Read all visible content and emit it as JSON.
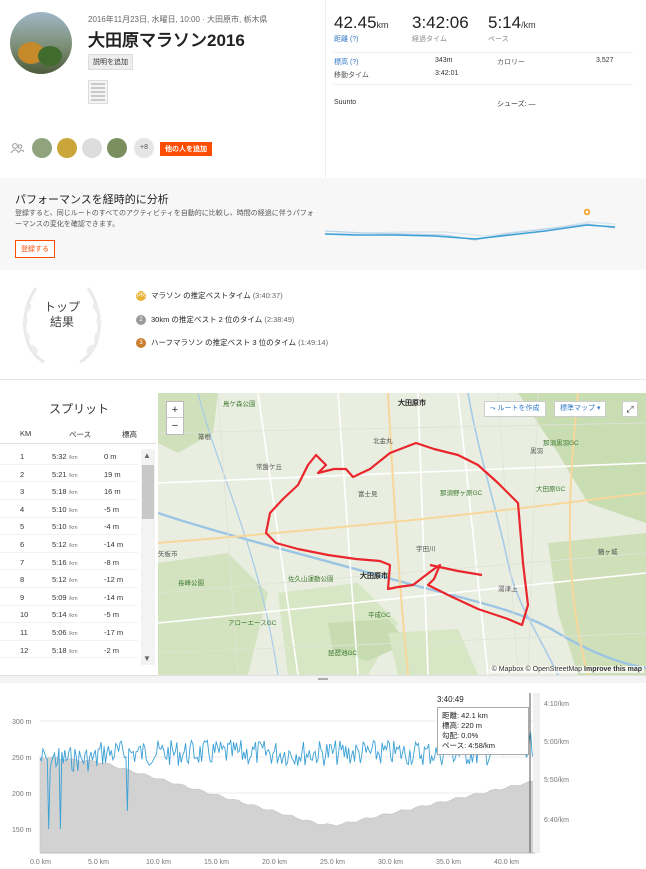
{
  "activity": {
    "meta": "2016年11月23日, 水曜日, 10:00 · 大田原市, 栃木県",
    "title": "大田原マラソン2016",
    "add_description": "説明を追加",
    "add_others": "他の人を追加",
    "others_count": "+8"
  },
  "stats": {
    "distance": {
      "value": "42.45",
      "unit": "km",
      "label": "距離 (?)"
    },
    "elapsed": {
      "value": "3:42:06",
      "unit": "",
      "label": "経過タイム"
    },
    "pace": {
      "value": "5:14",
      "unit": "/km",
      "label": "ペース"
    },
    "elevation_label": "標高 (?)",
    "elevation_value": "343m",
    "calories_label": "カロリー",
    "calories_value": "3,527",
    "moving_label": "移動タイム",
    "moving_value": "3:42:01",
    "device": "Suunto",
    "shoes_label": "シューズ: —"
  },
  "performance": {
    "title": "パフォーマンスを経時的に分析",
    "text": "登録すると、同じルートのすべてのアクティビティを自動的に比較し、時間の経過に伴うパフォーマンスの変化を確認できます。",
    "button": "登録する"
  },
  "top_results": {
    "title_line1": "トップ",
    "title_line2": "結果",
    "items": [
      {
        "medal": "PR",
        "text": "マラソン の推定ベストタイム",
        "time": "(3:40:37)",
        "color": "#e8b233"
      },
      {
        "medal": "2",
        "text": "30km の推定ベスト 2 位のタイム",
        "time": "(2:38:49)",
        "color": "#999999"
      },
      {
        "medal": "3",
        "text": "ハーフマラソン の推定ベスト 3 位のタイム",
        "time": "(1:49:14)",
        "color": "#c97f2e"
      }
    ]
  },
  "splits": {
    "title": "スプリット",
    "headers": [
      "KM",
      "ペース",
      "標高"
    ],
    "pace_unit": "/km",
    "rows": [
      {
        "km": "1",
        "pace": "5:32",
        "elev": "0 m"
      },
      {
        "km": "2",
        "pace": "5:21",
        "elev": "19 m"
      },
      {
        "km": "3",
        "pace": "5:18",
        "elev": "16 m"
      },
      {
        "km": "4",
        "pace": "5:10",
        "elev": "-5 m"
      },
      {
        "km": "5",
        "pace": "5:10",
        "elev": "-4 m"
      },
      {
        "km": "6",
        "pace": "5:12",
        "elev": "-14 m"
      },
      {
        "km": "7",
        "pace": "5:16",
        "elev": "-8 m"
      },
      {
        "km": "8",
        "pace": "5:12",
        "elev": "-12 m"
      },
      {
        "km": "9",
        "pace": "5:09",
        "elev": "-14 m"
      },
      {
        "km": "10",
        "pace": "5:14",
        "elev": "-5 m"
      },
      {
        "km": "11",
        "pace": "5:06",
        "elev": "-17 m"
      },
      {
        "km": "12",
        "pace": "5:18",
        "elev": "-2 m"
      }
    ]
  },
  "map": {
    "create_route": "ルートを作成",
    "map_type": "標準マップ",
    "zoom_in": "+",
    "zoom_out": "−",
    "fullscreen": "⤢",
    "attribution": "© Mapbox © OpenStreetMap",
    "improve": "Improve this map",
    "route_color": "#e8262c",
    "labels": [
      {
        "t": "大田原市",
        "c": "city"
      },
      {
        "t": "鳥ケ森公園",
        "c": "park"
      },
      {
        "t": "常盤ケ丘",
        "c": ""
      },
      {
        "t": "那須野ヶ原GC",
        "c": "park"
      },
      {
        "t": "大田原GC",
        "c": "park"
      },
      {
        "t": "那須黒羽GC",
        "c": "park"
      },
      {
        "t": "長峰公園",
        "c": "park"
      },
      {
        "t": "佐久山運動公園",
        "c": "park"
      },
      {
        "t": "大田原市",
        "c": "city"
      },
      {
        "t": "アローエースGC",
        "c": "park"
      },
      {
        "t": "平成GC",
        "c": "park"
      },
      {
        "t": "琵琶池GC",
        "c": "park"
      },
      {
        "t": "鶴ヶ城",
        "c": ""
      },
      {
        "t": "北金丸",
        "c": ""
      },
      {
        "t": "富士見",
        "c": ""
      },
      {
        "t": "宇田川",
        "c": ""
      },
      {
        "t": "湯津上",
        "c": ""
      },
      {
        "t": "黒羽",
        "c": ""
      },
      {
        "t": "箒根",
        "c": ""
      },
      {
        "t": "矢板市",
        "c": ""
      }
    ]
  },
  "elevation_chart": {
    "y_labels": [
      "300 m",
      "250 m",
      "200 m",
      "150 m"
    ],
    "right_labels": [
      "4:10/km",
      "5:00/km",
      "5:50/km",
      "6:40/km"
    ],
    "x_labels": [
      "0.0 km",
      "5.0 km",
      "10.0 km",
      "15.0 km",
      "20.0 km",
      "25.0 km",
      "30.0 km",
      "35.0 km",
      "40.0 km"
    ],
    "hover_time": "3:40:49",
    "tooltip": {
      "distance": "距離: 42.1 km",
      "elevation": "標高: 220 m",
      "grade": "勾配: 0.0%",
      "pace": "ペース: 4:58/km"
    },
    "elev_fill": "#d2d2d2",
    "pace_color": "#3aa0d6"
  }
}
